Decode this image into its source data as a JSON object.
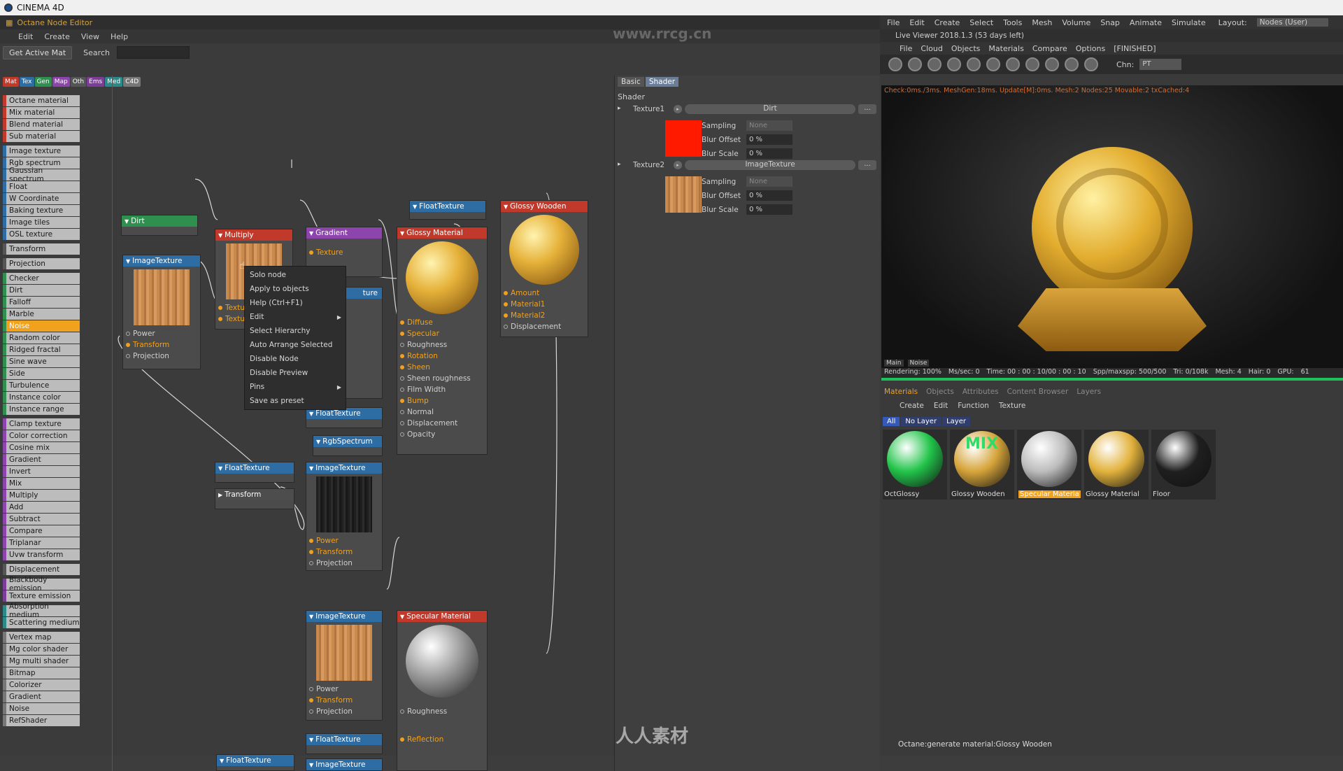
{
  "app": {
    "title": "CINEMA 4D"
  },
  "editor": {
    "title": "Octane Node Editor",
    "menu": [
      "Edit",
      "Create",
      "View",
      "Help"
    ],
    "get_active_mat": "Get Active Mat",
    "search_label": "Search",
    "cat_tabs": [
      {
        "label": "Mat",
        "color": "#c0392b"
      },
      {
        "label": "Tex",
        "color": "#2e6da4"
      },
      {
        "label": "Gen",
        "color": "#2f8f4e"
      },
      {
        "label": "Map",
        "color": "#8e44ad"
      },
      {
        "label": "Oth",
        "color": "#555555"
      },
      {
        "label": "Ems",
        "color": "#7d3c98"
      },
      {
        "label": "Med",
        "color": "#2a8a8a"
      },
      {
        "label": "C4D",
        "color": "#777777"
      }
    ],
    "palette": [
      {
        "label": "Octane material",
        "color": "#c0392b"
      },
      {
        "label": "Mix material",
        "color": "#c0392b"
      },
      {
        "label": "Blend material",
        "color": "#c0392b"
      },
      {
        "label": "Sub material",
        "color": "#c0392b"
      },
      {
        "gap": true
      },
      {
        "label": "Image texture",
        "color": "#2e6da4"
      },
      {
        "label": "Rgb spectrum",
        "color": "#2e6da4"
      },
      {
        "label": "Gaussian spectrum",
        "color": "#2e6da4"
      },
      {
        "label": "Float",
        "color": "#2e6da4"
      },
      {
        "label": "W Coordinate",
        "color": "#2e6da4"
      },
      {
        "label": "Baking texture",
        "color": "#2e6da4"
      },
      {
        "label": "Image tiles",
        "color": "#2e6da4"
      },
      {
        "label": "OSL texture",
        "color": "#2e6da4"
      },
      {
        "gap": true
      },
      {
        "label": "Transform",
        "color": "#555555"
      },
      {
        "gap": true
      },
      {
        "label": "Projection",
        "color": "#555555"
      },
      {
        "gap": true
      },
      {
        "label": "Checker",
        "color": "#2f8f4e"
      },
      {
        "label": "Dirt",
        "color": "#2f8f4e"
      },
      {
        "label": "Falloff",
        "color": "#2f8f4e"
      },
      {
        "label": "Marble",
        "color": "#2f8f4e"
      },
      {
        "label": "Noise",
        "color": "#2f8f4e",
        "selected": true
      },
      {
        "label": "Random color",
        "color": "#2f8f4e"
      },
      {
        "label": "Ridged fractal",
        "color": "#2f8f4e"
      },
      {
        "label": "Sine wave",
        "color": "#2f8f4e"
      },
      {
        "label": "Side",
        "color": "#2f8f4e"
      },
      {
        "label": "Turbulence",
        "color": "#2f8f4e"
      },
      {
        "label": "Instance color",
        "color": "#2f8f4e"
      },
      {
        "label": "Instance range",
        "color": "#2f8f4e"
      },
      {
        "gap": true
      },
      {
        "label": "Clamp texture",
        "color": "#8e44ad"
      },
      {
        "label": "Color correction",
        "color": "#8e44ad"
      },
      {
        "label": "Cosine mix",
        "color": "#8e44ad"
      },
      {
        "label": "Gradient",
        "color": "#8e44ad"
      },
      {
        "label": "Invert",
        "color": "#8e44ad"
      },
      {
        "label": "Mix",
        "color": "#8e44ad"
      },
      {
        "label": "Multiply",
        "color": "#8e44ad"
      },
      {
        "label": "Add",
        "color": "#8e44ad"
      },
      {
        "label": "Subtract",
        "color": "#8e44ad"
      },
      {
        "label": "Compare",
        "color": "#8e44ad"
      },
      {
        "label": "Triplanar",
        "color": "#8e44ad"
      },
      {
        "label": "Uvw transform",
        "color": "#8e44ad"
      },
      {
        "gap": true
      },
      {
        "label": "Displacement",
        "color": "#555555"
      },
      {
        "gap": true
      },
      {
        "label": "Blackbody emission",
        "color": "#7d3c98"
      },
      {
        "label": "Texture emission",
        "color": "#7d3c98"
      },
      {
        "gap": true
      },
      {
        "label": "Absorption medium",
        "color": "#2a8a8a"
      },
      {
        "label": "Scattering medium",
        "color": "#2a8a8a"
      },
      {
        "gap": true
      },
      {
        "label": "Vertex map",
        "color": "#777777"
      },
      {
        "label": "Mg color shader",
        "color": "#777777"
      },
      {
        "label": "Mg multi shader",
        "color": "#777777"
      },
      {
        "label": "Bitmap",
        "color": "#777777"
      },
      {
        "label": "Colorizer",
        "color": "#777777"
      },
      {
        "label": "Gradient",
        "color": "#777777"
      },
      {
        "label": "Noise",
        "color": "#777777"
      },
      {
        "label": "RefShader",
        "color": "#777777"
      }
    ]
  },
  "nodes": {
    "dirt": {
      "title": "Dirt"
    },
    "imagetexture1": {
      "title": "ImageTexture",
      "pins": [
        "Power",
        "Transform",
        "Projection"
      ]
    },
    "multiply": {
      "title": "Multiply",
      "pins": [
        "Textu",
        "Textu"
      ]
    },
    "gradient": {
      "title": "Gradient",
      "pins": [
        "Texture"
      ]
    },
    "floattexture_top": {
      "title": "FloatTexture"
    },
    "glossy_material": {
      "title": "Glossy Material",
      "pins": [
        "Diffuse",
        "Specular",
        "Roughness",
        "Rotation",
        "Sheen",
        "Sheen roughness",
        "Film Width",
        "Bump",
        "Normal",
        "Displacement",
        "Opacity"
      ]
    },
    "glossy_wooden": {
      "title": "Glossy Wooden",
      "pins": [
        "Amount",
        "Material1",
        "Material2",
        "Displacement"
      ]
    },
    "texture_partial": {
      "title": "ture"
    },
    "floattexture_mid": {
      "title": "FloatTexture"
    },
    "rgbspectrum": {
      "title": "RgbSpectrum"
    },
    "floattexture_left": {
      "title": "FloatTexture"
    },
    "transform": {
      "title": "Transform"
    },
    "imagetexture2": {
      "title": "ImageTexture",
      "pins": [
        "Power",
        "Transform",
        "Projection"
      ]
    },
    "imagetexture3": {
      "title": "ImageTexture",
      "pins": [
        "Power",
        "Transform",
        "Projection"
      ]
    },
    "specular_material": {
      "title": "Specular Material",
      "pins": [
        "Roughness",
        "Reflection"
      ]
    },
    "floattexture_b1": {
      "title": "FloatTexture"
    },
    "floattexture_b2": {
      "title": "FloatTexture"
    },
    "imagetexture4": {
      "title": "ImageTexture"
    }
  },
  "context_menu": {
    "items": [
      "Solo node",
      "Apply to objects",
      "Help (Ctrl+F1)",
      "Edit",
      "Select Hierarchy",
      "Auto Arrange Selected",
      "Disable Node",
      "Disable Preview",
      "Pins",
      "Save as preset"
    ],
    "submenu": [
      "Edit",
      "Pins"
    ]
  },
  "attributes": {
    "tabs": [
      "Basic",
      "Shader"
    ],
    "section": "Shader",
    "texture1": {
      "label": "Texture1",
      "value": "Dirt",
      "more": "...",
      "swatch_color": "#ff1a00"
    },
    "texture2": {
      "label": "Texture2",
      "value": "ImageTexture",
      "more": "...",
      "swatch_color": "#c8894a"
    },
    "fields": {
      "sampling": "Sampling",
      "sampling_value": "None",
      "blur_offset": "Blur Offset",
      "blur_offset_value": "0 %",
      "blur_scale": "Blur Scale",
      "blur_scale_value": "0 %"
    }
  },
  "c4d_menu": [
    "File",
    "Edit",
    "Create",
    "Select",
    "Tools",
    "Mesh",
    "Volume",
    "Snap",
    "Animate",
    "Simulate"
  ],
  "layout": {
    "label": "Layout:",
    "value": "Nodes (User)"
  },
  "live_viewer": {
    "title": "Live Viewer 2018.1.3 (53 days left)",
    "menu": [
      "File",
      "Cloud",
      "Objects",
      "Materials",
      "Compare",
      "Options",
      "[FINISHED]"
    ],
    "chn_label": "Chn:",
    "chn_value": "PT",
    "status": "Check:0ms./3ms. MeshGen:18ms. Update[M]:0ms. Mesh:2 Nodes:25 Movable:2 txCached:4",
    "tabs": [
      "Main",
      "Noise"
    ],
    "render_stats": [
      "Rendering: 100%",
      "Ms/sec: 0",
      "Time: 00 : 00 : 10/00 : 00 : 10",
      "Spp/maxspp: 500/500",
      "Tri: 0/108k",
      "Mesh: 4",
      "Hair: 0",
      "GPU:",
      "61"
    ]
  },
  "materials": {
    "tabs": [
      "Materials",
      "Objects",
      "Attributes",
      "Content Browser",
      "Layers"
    ],
    "menu": [
      "Create",
      "Edit",
      "Function",
      "Texture"
    ],
    "layer_tabs": [
      "All",
      "No Layer",
      "Layer"
    ],
    "items": [
      {
        "label": "OctGlossy",
        "color": "#22c44a"
      },
      {
        "label": "Glossy Wooden",
        "color": "#d6a43a",
        "mix": "MIX"
      },
      {
        "label": "Specular Materia",
        "color": "#bcbcbc",
        "selected": true
      },
      {
        "label": "Glossy Material",
        "color": "#e2b23c"
      },
      {
        "label": "Floor",
        "color": "#1f1f1f"
      }
    ]
  },
  "status_bar": "Octane:generate material:Glossy Wooden",
  "watermark": {
    "url": "www.rrcg.cn",
    "brand": "人人素材"
  },
  "colors": {
    "accent": "#f0a11e",
    "progress": "#1bc35a"
  }
}
